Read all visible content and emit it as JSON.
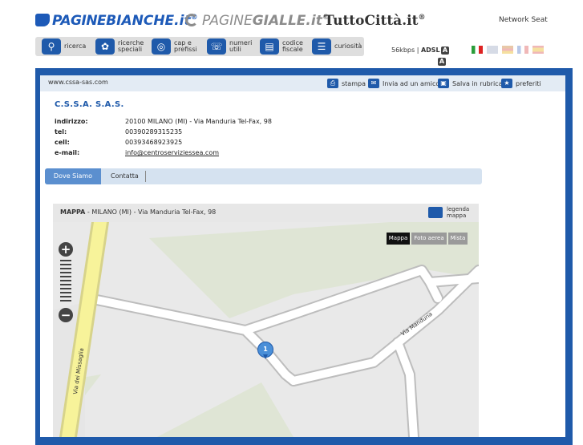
{
  "header": {
    "brand_pb_a": "PAGINE",
    "brand_pb_b": "BIANCHE",
    "brand_pb_c": ".it",
    "brand_pg_a": "PAGINE",
    "brand_pg_b": "GIALLE",
    "brand_pg_c": ".it",
    "brand_tc": "TuttoCittà",
    "brand_tc_c": ".it",
    "sup": "®",
    "network": "Network Seat"
  },
  "nav": [
    {
      "label": "ricerca",
      "icon": "search-icon"
    },
    {
      "label": "ricerche\nspeciali",
      "icon": "puzzle-icon"
    },
    {
      "label": "cap e\nprefissi",
      "icon": "globe-icon"
    },
    {
      "label": "numeri\nutili",
      "icon": "phone-icon"
    },
    {
      "label": "codice\nfiscale",
      "icon": "card-icon"
    },
    {
      "label": "curiosità",
      "icon": "book-icon"
    }
  ],
  "connection": {
    "speed": "56kbps",
    "sep": "|",
    "adsl": "ADSL",
    "a_label": "A"
  },
  "languages": [
    "it",
    "en",
    "de",
    "fr",
    "es"
  ],
  "toolbar": {
    "url": "www.cssa-sas.com",
    "actions": [
      {
        "label": "stampa",
        "icon": "printer-icon"
      },
      {
        "label": "Invia ad un amico",
        "icon": "mail-icon"
      },
      {
        "label": "Salva in rubrica",
        "icon": "folder-icon"
      },
      {
        "label": "preferiti",
        "icon": "star-icon"
      }
    ]
  },
  "company": {
    "name": "C.S.S.A. S.A.S.",
    "rows": [
      {
        "label": "indirizzo:",
        "value": "20100 MILANO (MI) - Via Manduria Tel-Fax, 98"
      },
      {
        "label": "tel:",
        "value": "00390289315235"
      },
      {
        "label": "cell:",
        "value": "00393468923925"
      },
      {
        "label": "e-mail:",
        "value": "info@centroserviziessea.com"
      }
    ]
  },
  "tabs": {
    "active": "Dove Siamo",
    "other": "Contatta"
  },
  "map": {
    "title": "MAPPA",
    "subtitle": " - MILANO (MI) - Via Manduria Tel-Fax, 98",
    "legend": "legenda\nmappa",
    "types": [
      "Mappa",
      "Foto aerea",
      "Mista"
    ],
    "streets": [
      "Via Manduria",
      "Via dei Missaglia"
    ],
    "pin_label": "1",
    "zoom_in": "+",
    "zoom_out": "−"
  },
  "colors": {
    "accent": "#1f5aaa",
    "road_yellow": "#f7f39a",
    "land": "#dfe5d5"
  }
}
